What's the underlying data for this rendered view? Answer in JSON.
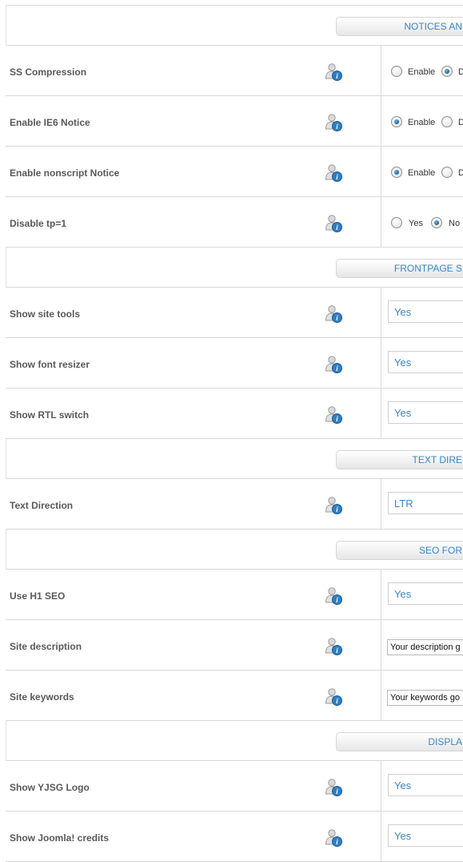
{
  "sections": {
    "notices": "NOTICES AN",
    "frontpage": "FRONTPAGE S",
    "text_direction": "TEXT DIRE",
    "seo": "SEO FOR",
    "display": "DISPLA"
  },
  "rows": {
    "ss_compression": {
      "label": "SS Compression",
      "opt1": "Enable",
      "opt2": "D",
      "selected": "opt2"
    },
    "ie6_notice": {
      "label": "Enable IE6 Notice",
      "opt1": "Enable",
      "opt2": "D",
      "selected": "opt1"
    },
    "nonscript_notice": {
      "label": "Enable nonscript Notice",
      "opt1": "Enable",
      "opt2": "D",
      "selected": "opt1"
    },
    "disable_tp": {
      "label": "Disable tp=1",
      "opt1": "Yes",
      "opt2": "No",
      "selected": "opt2"
    },
    "site_tools": {
      "label": "Show site tools",
      "value": "Yes"
    },
    "font_resizer": {
      "label": "Show font resizer",
      "value": "Yes"
    },
    "rtl_switch": {
      "label": "Show RTL switch",
      "value": "Yes"
    },
    "text_direction": {
      "label": "Text Direction",
      "value": "LTR"
    },
    "h1_seo": {
      "label": "Use H1 SEO",
      "value": "Yes"
    },
    "site_description": {
      "label": "Site description",
      "value": "Your description g"
    },
    "site_keywords": {
      "label": "Site keywords",
      "value": "Your keywords go"
    },
    "yjsg_logo": {
      "label": "Show YJSG Logo",
      "value": "Yes"
    },
    "joomla_credits": {
      "label": "Show Joomla! credits",
      "value": "Yes"
    }
  },
  "icons": {
    "info": "user-info-icon"
  },
  "colors": {
    "accent": "#3a86c8",
    "radio_checked": "#1f6fb0",
    "label": "#595959"
  }
}
